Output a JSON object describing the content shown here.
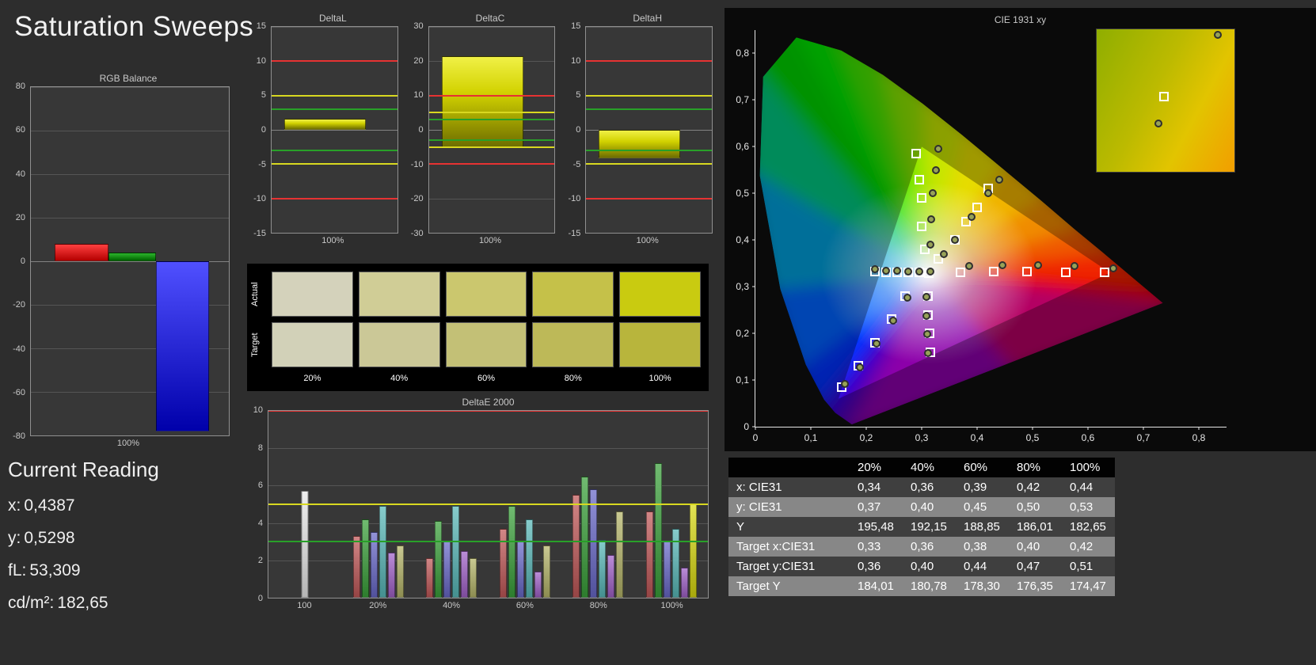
{
  "title": "Saturation Sweeps",
  "rgb_balance": {
    "title": "RGB Balance",
    "xlabel": "100%",
    "ylim": [
      -80,
      80
    ],
    "yticks": [
      80,
      60,
      40,
      20,
      0,
      -20,
      -40,
      -60,
      -80
    ],
    "bars": [
      {
        "name": "red",
        "value": 8
      },
      {
        "name": "green",
        "value": 4
      },
      {
        "name": "blue",
        "value": -78
      }
    ]
  },
  "reference_lines": [
    {
      "level": 10,
      "color": "#e63232"
    },
    {
      "level": 5,
      "color": "#d8d820"
    },
    {
      "level": 3,
      "color": "#28a028"
    }
  ],
  "delta_charts": [
    {
      "title": "DeltaL",
      "xlabel": "100%",
      "ylim": [
        -15,
        15
      ],
      "yticks": [
        15,
        10,
        5,
        0,
        -5,
        -10,
        -15
      ],
      "bar_from": 0,
      "bar_to": 1.6
    },
    {
      "title": "DeltaC",
      "xlabel": "100%",
      "ylim": [
        -30,
        30
      ],
      "yticks": [
        30,
        20,
        10,
        0,
        -10,
        -20,
        -30
      ],
      "bar_from": -5,
      "bar_to": 21.5
    },
    {
      "title": "DeltaH",
      "xlabel": "100%",
      "ylim": [
        -15,
        15
      ],
      "yticks": [
        15,
        10,
        5,
        0,
        -5,
        -10,
        -15
      ],
      "bar_from": 0,
      "bar_to": -4.2
    }
  ],
  "swatches": {
    "row_labels": [
      "Actual",
      "Target"
    ],
    "col_labels": [
      "20%",
      "40%",
      "60%",
      "80%",
      "100%"
    ],
    "actual": [
      "#d4d2bb",
      "#d0cd96",
      "#cbc76e",
      "#c5c149",
      "#c9cb10"
    ],
    "target": [
      "#d2d1b8",
      "#cbc897",
      "#c3c076",
      "#bdb958",
      "#b8b53c"
    ]
  },
  "deltae2000": {
    "title": "DeltaE 2000",
    "ylim": [
      0,
      10
    ],
    "yticks": [
      10,
      8,
      6,
      4,
      2,
      0
    ],
    "groups": [
      {
        "label": "100",
        "bars": [
          {
            "c": "#e8e8e8",
            "v": 5.7
          }
        ]
      },
      {
        "label": "20%",
        "bars": [
          {
            "c": "#c05858",
            "v": 3.3
          },
          {
            "c": "#3aa03a",
            "v": 4.2
          },
          {
            "c": "#6868c8",
            "v": 3.5
          },
          {
            "c": "#58b8b8",
            "v": 4.9
          },
          {
            "c": "#a060c8",
            "v": 2.4
          },
          {
            "c": "#b4b468",
            "v": 2.8
          }
        ]
      },
      {
        "label": "40%",
        "bars": [
          {
            "c": "#c05858",
            "v": 2.1
          },
          {
            "c": "#3aa03a",
            "v": 4.1
          },
          {
            "c": "#6868c8",
            "v": 3.0
          },
          {
            "c": "#58b8b8",
            "v": 4.9
          },
          {
            "c": "#a060c8",
            "v": 2.5
          },
          {
            "c": "#b4b468",
            "v": 2.1
          }
        ]
      },
      {
        "label": "60%",
        "bars": [
          {
            "c": "#c05858",
            "v": 3.7
          },
          {
            "c": "#3aa03a",
            "v": 4.9
          },
          {
            "c": "#6868c8",
            "v": 3.0
          },
          {
            "c": "#58b8b8",
            "v": 4.2
          },
          {
            "c": "#a060c8",
            "v": 1.4
          },
          {
            "c": "#b4b468",
            "v": 2.8
          }
        ]
      },
      {
        "label": "80%",
        "bars": [
          {
            "c": "#c05858",
            "v": 5.5
          },
          {
            "c": "#3aa03a",
            "v": 6.5
          },
          {
            "c": "#6868c8",
            "v": 5.8
          },
          {
            "c": "#58b8b8",
            "v": 3.1
          },
          {
            "c": "#a060c8",
            "v": 2.3
          },
          {
            "c": "#b4b468",
            "v": 4.6
          }
        ]
      },
      {
        "label": "100%",
        "bars": [
          {
            "c": "#c05858",
            "v": 4.6
          },
          {
            "c": "#3aa03a",
            "v": 7.2
          },
          {
            "c": "#6868c8",
            "v": 3.0
          },
          {
            "c": "#58b8b8",
            "v": 3.7
          },
          {
            "c": "#a060c8",
            "v": 1.6
          },
          {
            "c": "#d8d810",
            "v": 5.0
          }
        ]
      }
    ]
  },
  "cie": {
    "title": "CIE 1931 xy",
    "axis_max": 0.85,
    "tick_values": [
      0,
      0.1,
      0.2,
      0.3,
      0.4,
      0.5,
      0.6,
      0.7,
      0.8
    ],
    "tick_labels": [
      "0",
      "0,1",
      "0,2",
      "0,3",
      "0,4",
      "0,5",
      "0,6",
      "0,7",
      "0,8"
    ],
    "whitepoint": [
      0.313,
      0.329
    ],
    "gamut_triangle": [
      [
        0.64,
        0.33
      ],
      [
        0.3,
        0.6
      ],
      [
        0.15,
        0.06
      ]
    ],
    "locus": [
      [
        0.174,
        0.005,
        "#5000b4"
      ],
      [
        0.144,
        0.03,
        "#2800dc"
      ],
      [
        0.124,
        0.058,
        "#0030ff"
      ],
      [
        0.091,
        0.133,
        "#0064ff"
      ],
      [
        0.045,
        0.295,
        "#00a0dc"
      ],
      [
        0.008,
        0.538,
        "#00c882"
      ],
      [
        0.014,
        0.75,
        "#00d200"
      ],
      [
        0.074,
        0.834,
        "#00e600"
      ],
      [
        0.155,
        0.806,
        "#46e600"
      ],
      [
        0.23,
        0.754,
        "#8ce600"
      ],
      [
        0.302,
        0.692,
        "#c8e600"
      ],
      [
        0.373,
        0.625,
        "#e6dc00"
      ],
      [
        0.444,
        0.555,
        "#f0b400"
      ],
      [
        0.513,
        0.487,
        "#f08c00"
      ],
      [
        0.575,
        0.424,
        "#f05a00"
      ],
      [
        0.627,
        0.373,
        "#f02800"
      ],
      [
        0.692,
        0.308,
        "#e60000"
      ],
      [
        0.735,
        0.265,
        "#b40064"
      ],
      [
        0.455,
        0.135,
        "#8c00aa"
      ]
    ],
    "target_points": [
      [
        0.313,
        0.329
      ],
      [
        0.37,
        0.331
      ],
      [
        0.43,
        0.332
      ],
      [
        0.49,
        0.332
      ],
      [
        0.56,
        0.331
      ],
      [
        0.63,
        0.33
      ],
      [
        0.305,
        0.38
      ],
      [
        0.3,
        0.43
      ],
      [
        0.3,
        0.49
      ],
      [
        0.295,
        0.53
      ],
      [
        0.29,
        0.585
      ],
      [
        0.27,
        0.28
      ],
      [
        0.245,
        0.23
      ],
      [
        0.215,
        0.18
      ],
      [
        0.185,
        0.13
      ],
      [
        0.155,
        0.085
      ],
      [
        0.295,
        0.33
      ],
      [
        0.275,
        0.33
      ],
      [
        0.255,
        0.33
      ],
      [
        0.235,
        0.331
      ],
      [
        0.215,
        0.332
      ],
      [
        0.312,
        0.28
      ],
      [
        0.312,
        0.24
      ],
      [
        0.314,
        0.2
      ],
      [
        0.316,
        0.16
      ],
      [
        0.33,
        0.36
      ],
      [
        0.36,
        0.4
      ],
      [
        0.38,
        0.44
      ],
      [
        0.4,
        0.47
      ],
      [
        0.42,
        0.51
      ]
    ],
    "measured_points": [
      [
        0.316,
        0.333
      ],
      [
        0.385,
        0.345
      ],
      [
        0.445,
        0.346
      ],
      [
        0.51,
        0.346
      ],
      [
        0.575,
        0.344
      ],
      [
        0.645,
        0.34
      ],
      [
        0.315,
        0.39
      ],
      [
        0.317,
        0.445
      ],
      [
        0.32,
        0.5
      ],
      [
        0.325,
        0.55
      ],
      [
        0.33,
        0.595
      ],
      [
        0.274,
        0.276
      ],
      [
        0.248,
        0.228
      ],
      [
        0.218,
        0.178
      ],
      [
        0.188,
        0.128
      ],
      [
        0.162,
        0.092
      ],
      [
        0.296,
        0.333
      ],
      [
        0.276,
        0.333
      ],
      [
        0.256,
        0.334
      ],
      [
        0.236,
        0.335
      ],
      [
        0.216,
        0.337
      ],
      [
        0.308,
        0.278
      ],
      [
        0.308,
        0.238
      ],
      [
        0.31,
        0.198
      ],
      [
        0.312,
        0.158
      ],
      [
        0.34,
        0.37
      ],
      [
        0.36,
        0.4
      ],
      [
        0.39,
        0.45
      ],
      [
        0.42,
        0.5
      ],
      [
        0.44,
        0.53
      ]
    ],
    "inset": {
      "markers": [
        {
          "type": "square",
          "x": 49,
          "y": 47
        },
        {
          "type": "circle",
          "x": 45,
          "y": 66
        },
        {
          "type": "circle",
          "x": 88,
          "y": 4
        }
      ]
    }
  },
  "current_reading": {
    "heading": "Current Reading",
    "lines": [
      {
        "label": "x:",
        "value": "0,4387"
      },
      {
        "label": "y:",
        "value": "0,5298"
      },
      {
        "label": "fL:",
        "value": "53,309"
      },
      {
        "label": "cd/m²:",
        "value": "182,65"
      }
    ]
  },
  "table": {
    "columns": [
      "",
      "20%",
      "40%",
      "60%",
      "80%",
      "100%"
    ],
    "rows": [
      {
        "label": "x: CIE31",
        "values": [
          "0,34",
          "0,36",
          "0,39",
          "0,42",
          "0,44"
        ]
      },
      {
        "label": "y: CIE31",
        "values": [
          "0,37",
          "0,40",
          "0,45",
          "0,50",
          "0,53"
        ]
      },
      {
        "label": "Y",
        "values": [
          "195,48",
          "192,15",
          "188,85",
          "186,01",
          "182,65"
        ]
      },
      {
        "label": "Target x:CIE31",
        "values": [
          "0,33",
          "0,36",
          "0,38",
          "0,40",
          "0,42"
        ]
      },
      {
        "label": "Target y:CIE31",
        "values": [
          "0,36",
          "0,40",
          "0,44",
          "0,47",
          "0,51"
        ]
      },
      {
        "label": "Target Y",
        "values": [
          "184,01",
          "180,78",
          "178,30",
          "176,35",
          "174,47"
        ]
      }
    ]
  }
}
